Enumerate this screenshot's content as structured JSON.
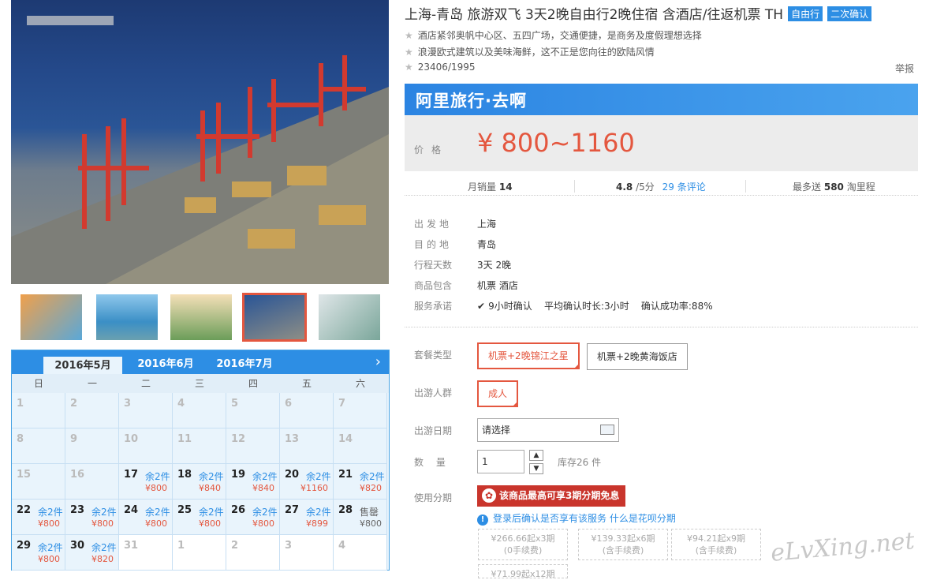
{
  "product": {
    "title": "上海-青岛 旅游双飞 3天2晚自由行2晚住宿 含酒店/往返机票 TH",
    "tags": [
      "自由行",
      "二次确认"
    ],
    "features": [
      "酒店紧邻奥帆中心区、五四广场，交通便捷，是商务及度假理想选择",
      "浪漫欧式建筑以及美味海鲜，这不正是您向往的欧陆风情"
    ],
    "id_line": "23406/1995",
    "report": "举报"
  },
  "banner": {
    "brand": "阿里旅行·去啊"
  },
  "price": {
    "label": "价格",
    "value": "¥ 800~1160"
  },
  "stats": {
    "sales_label": "月销量",
    "sales_value": "14",
    "rating_value": "4.8",
    "rating_unit": "/5分",
    "reviews": "29 条评论",
    "points_prefix": "最多送",
    "points_value": "580",
    "points_suffix": "淘里程"
  },
  "info": [
    {
      "label": "出发地",
      "value": "上海"
    },
    {
      "label": "目的地",
      "value": "青岛"
    },
    {
      "label": "行程天数",
      "value": "3天 2晚"
    },
    {
      "label": "商品包含",
      "value": "机票  酒店"
    },
    {
      "label": "服务承诺",
      "value": "9小时确认    平均确认时长:3小时    确认成功率:88%"
    }
  ],
  "options": {
    "package_label": "套餐类型",
    "packages": [
      "机票+2晚锦江之星",
      "机票+2晚黄海饭店"
    ],
    "people_label": "出游人群",
    "people": [
      "成人"
    ],
    "date_label": "出游日期",
    "date_value": "请选择",
    "qty_label": "数  量",
    "qty_value": "1",
    "stock": "库存26 件",
    "install_label": "使用分期",
    "install_banner": "该商品最高可享3期分期免息",
    "install_note": "登录后确认是否享有该服务 什么是花呗分期",
    "installments": [
      {
        "amount": "¥266.66起x3期",
        "fee": "(0手续费)"
      },
      {
        "amount": "¥139.33起x6期",
        "fee": "(含手续费)"
      },
      {
        "amount": "¥94.21起x9期",
        "fee": "(含手续费)"
      },
      {
        "amount": "¥71.99起x12期",
        "fee": ""
      }
    ]
  },
  "calendar": {
    "months": [
      "2016年5月",
      "2016年6月",
      "2016年7月"
    ],
    "weekdays": [
      "日",
      "一",
      "二",
      "三",
      "四",
      "五",
      "六"
    ],
    "days": [
      {
        "d": "1"
      },
      {
        "d": "2"
      },
      {
        "d": "3"
      },
      {
        "d": "4"
      },
      {
        "d": "5"
      },
      {
        "d": "6"
      },
      {
        "d": "7"
      },
      {
        "d": "8"
      },
      {
        "d": "9"
      },
      {
        "d": "10"
      },
      {
        "d": "11"
      },
      {
        "d": "12"
      },
      {
        "d": "13"
      },
      {
        "d": "14"
      },
      {
        "d": "15"
      },
      {
        "d": "16"
      },
      {
        "d": "17",
        "r": "余2件",
        "p": "¥800"
      },
      {
        "d": "18",
        "r": "余2件",
        "p": "¥840"
      },
      {
        "d": "19",
        "r": "余2件",
        "p": "¥840"
      },
      {
        "d": "20",
        "r": "余2件",
        "p": "¥1160"
      },
      {
        "d": "21",
        "r": "余2件",
        "p": "¥820"
      },
      {
        "d": "22",
        "r": "余2件",
        "p": "¥800"
      },
      {
        "d": "23",
        "r": "余2件",
        "p": "¥800"
      },
      {
        "d": "24",
        "r": "余2件",
        "p": "¥800"
      },
      {
        "d": "25",
        "r": "余2件",
        "p": "¥800"
      },
      {
        "d": "26",
        "r": "余2件",
        "p": "¥800"
      },
      {
        "d": "27",
        "r": "余2件",
        "p": "¥899"
      },
      {
        "d": "28",
        "r": "售罄",
        "p": "¥800"
      },
      {
        "d": "29",
        "r": "余2件",
        "p": "¥800"
      },
      {
        "d": "30",
        "r": "余2件",
        "p": "¥820"
      },
      {
        "d": "31"
      },
      {
        "d": "1"
      },
      {
        "d": "2"
      },
      {
        "d": "3"
      },
      {
        "d": "4"
      }
    ]
  },
  "watermark": "eLvXing.net",
  "colors": {
    "accent": "#2d8ee4",
    "price": "#e4573f",
    "hb": "#c9352c"
  }
}
